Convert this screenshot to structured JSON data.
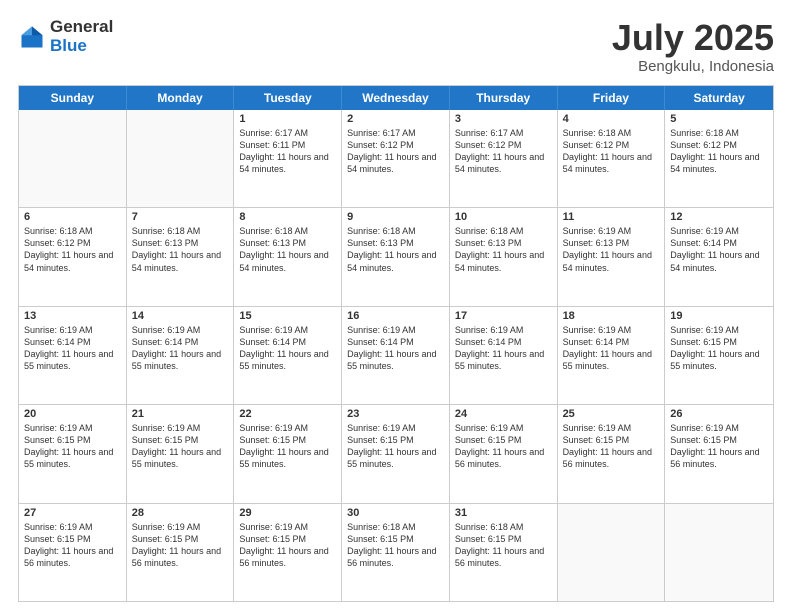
{
  "logo": {
    "general": "General",
    "blue": "Blue"
  },
  "title": {
    "month_year": "July 2025",
    "location": "Bengkulu, Indonesia"
  },
  "header_days": [
    "Sunday",
    "Monday",
    "Tuesday",
    "Wednesday",
    "Thursday",
    "Friday",
    "Saturday"
  ],
  "weeks": [
    [
      {
        "day": "",
        "empty": true
      },
      {
        "day": "",
        "empty": true
      },
      {
        "day": "1",
        "sunrise": "Sunrise: 6:17 AM",
        "sunset": "Sunset: 6:11 PM",
        "daylight": "Daylight: 11 hours and 54 minutes."
      },
      {
        "day": "2",
        "sunrise": "Sunrise: 6:17 AM",
        "sunset": "Sunset: 6:12 PM",
        "daylight": "Daylight: 11 hours and 54 minutes."
      },
      {
        "day": "3",
        "sunrise": "Sunrise: 6:17 AM",
        "sunset": "Sunset: 6:12 PM",
        "daylight": "Daylight: 11 hours and 54 minutes."
      },
      {
        "day": "4",
        "sunrise": "Sunrise: 6:18 AM",
        "sunset": "Sunset: 6:12 PM",
        "daylight": "Daylight: 11 hours and 54 minutes."
      },
      {
        "day": "5",
        "sunrise": "Sunrise: 6:18 AM",
        "sunset": "Sunset: 6:12 PM",
        "daylight": "Daylight: 11 hours and 54 minutes."
      }
    ],
    [
      {
        "day": "6",
        "sunrise": "Sunrise: 6:18 AM",
        "sunset": "Sunset: 6:12 PM",
        "daylight": "Daylight: 11 hours and 54 minutes."
      },
      {
        "day": "7",
        "sunrise": "Sunrise: 6:18 AM",
        "sunset": "Sunset: 6:13 PM",
        "daylight": "Daylight: 11 hours and 54 minutes."
      },
      {
        "day": "8",
        "sunrise": "Sunrise: 6:18 AM",
        "sunset": "Sunset: 6:13 PM",
        "daylight": "Daylight: 11 hours and 54 minutes."
      },
      {
        "day": "9",
        "sunrise": "Sunrise: 6:18 AM",
        "sunset": "Sunset: 6:13 PM",
        "daylight": "Daylight: 11 hours and 54 minutes."
      },
      {
        "day": "10",
        "sunrise": "Sunrise: 6:18 AM",
        "sunset": "Sunset: 6:13 PM",
        "daylight": "Daylight: 11 hours and 54 minutes."
      },
      {
        "day": "11",
        "sunrise": "Sunrise: 6:19 AM",
        "sunset": "Sunset: 6:13 PM",
        "daylight": "Daylight: 11 hours and 54 minutes."
      },
      {
        "day": "12",
        "sunrise": "Sunrise: 6:19 AM",
        "sunset": "Sunset: 6:14 PM",
        "daylight": "Daylight: 11 hours and 54 minutes."
      }
    ],
    [
      {
        "day": "13",
        "sunrise": "Sunrise: 6:19 AM",
        "sunset": "Sunset: 6:14 PM",
        "daylight": "Daylight: 11 hours and 55 minutes."
      },
      {
        "day": "14",
        "sunrise": "Sunrise: 6:19 AM",
        "sunset": "Sunset: 6:14 PM",
        "daylight": "Daylight: 11 hours and 55 minutes."
      },
      {
        "day": "15",
        "sunrise": "Sunrise: 6:19 AM",
        "sunset": "Sunset: 6:14 PM",
        "daylight": "Daylight: 11 hours and 55 minutes."
      },
      {
        "day": "16",
        "sunrise": "Sunrise: 6:19 AM",
        "sunset": "Sunset: 6:14 PM",
        "daylight": "Daylight: 11 hours and 55 minutes."
      },
      {
        "day": "17",
        "sunrise": "Sunrise: 6:19 AM",
        "sunset": "Sunset: 6:14 PM",
        "daylight": "Daylight: 11 hours and 55 minutes."
      },
      {
        "day": "18",
        "sunrise": "Sunrise: 6:19 AM",
        "sunset": "Sunset: 6:14 PM",
        "daylight": "Daylight: 11 hours and 55 minutes."
      },
      {
        "day": "19",
        "sunrise": "Sunrise: 6:19 AM",
        "sunset": "Sunset: 6:15 PM",
        "daylight": "Daylight: 11 hours and 55 minutes."
      }
    ],
    [
      {
        "day": "20",
        "sunrise": "Sunrise: 6:19 AM",
        "sunset": "Sunset: 6:15 PM",
        "daylight": "Daylight: 11 hours and 55 minutes."
      },
      {
        "day": "21",
        "sunrise": "Sunrise: 6:19 AM",
        "sunset": "Sunset: 6:15 PM",
        "daylight": "Daylight: 11 hours and 55 minutes."
      },
      {
        "day": "22",
        "sunrise": "Sunrise: 6:19 AM",
        "sunset": "Sunset: 6:15 PM",
        "daylight": "Daylight: 11 hours and 55 minutes."
      },
      {
        "day": "23",
        "sunrise": "Sunrise: 6:19 AM",
        "sunset": "Sunset: 6:15 PM",
        "daylight": "Daylight: 11 hours and 55 minutes."
      },
      {
        "day": "24",
        "sunrise": "Sunrise: 6:19 AM",
        "sunset": "Sunset: 6:15 PM",
        "daylight": "Daylight: 11 hours and 56 minutes."
      },
      {
        "day": "25",
        "sunrise": "Sunrise: 6:19 AM",
        "sunset": "Sunset: 6:15 PM",
        "daylight": "Daylight: 11 hours and 56 minutes."
      },
      {
        "day": "26",
        "sunrise": "Sunrise: 6:19 AM",
        "sunset": "Sunset: 6:15 PM",
        "daylight": "Daylight: 11 hours and 56 minutes."
      }
    ],
    [
      {
        "day": "27",
        "sunrise": "Sunrise: 6:19 AM",
        "sunset": "Sunset: 6:15 PM",
        "daylight": "Daylight: 11 hours and 56 minutes."
      },
      {
        "day": "28",
        "sunrise": "Sunrise: 6:19 AM",
        "sunset": "Sunset: 6:15 PM",
        "daylight": "Daylight: 11 hours and 56 minutes."
      },
      {
        "day": "29",
        "sunrise": "Sunrise: 6:19 AM",
        "sunset": "Sunset: 6:15 PM",
        "daylight": "Daylight: 11 hours and 56 minutes."
      },
      {
        "day": "30",
        "sunrise": "Sunrise: 6:18 AM",
        "sunset": "Sunset: 6:15 PM",
        "daylight": "Daylight: 11 hours and 56 minutes."
      },
      {
        "day": "31",
        "sunrise": "Sunrise: 6:18 AM",
        "sunset": "Sunset: 6:15 PM",
        "daylight": "Daylight: 11 hours and 56 minutes."
      },
      {
        "day": "",
        "empty": true
      },
      {
        "day": "",
        "empty": true
      }
    ]
  ]
}
